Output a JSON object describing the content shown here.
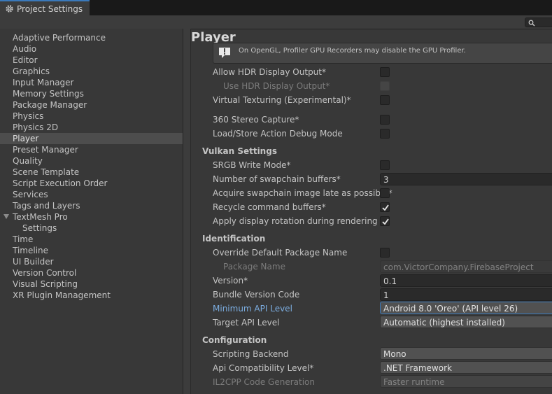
{
  "window": {
    "tab_title": "Project Settings",
    "search_placeholder": ""
  },
  "sidebar": {
    "items": [
      {
        "label": "Adaptive Performance"
      },
      {
        "label": "Audio"
      },
      {
        "label": "Editor"
      },
      {
        "label": "Graphics"
      },
      {
        "label": "Input Manager"
      },
      {
        "label": "Memory Settings"
      },
      {
        "label": "Package Manager"
      },
      {
        "label": "Physics"
      },
      {
        "label": "Physics 2D"
      },
      {
        "label": "Player",
        "selected": true
      },
      {
        "label": "Preset Manager"
      },
      {
        "label": "Quality"
      },
      {
        "label": "Scene Template"
      },
      {
        "label": "Script Execution Order"
      },
      {
        "label": "Services"
      },
      {
        "label": "Tags and Layers"
      },
      {
        "label": "TextMesh Pro",
        "expanded": true
      },
      {
        "label": "Settings",
        "child": true
      },
      {
        "label": "Time"
      },
      {
        "label": "Timeline"
      },
      {
        "label": "UI Builder"
      },
      {
        "label": "Version Control"
      },
      {
        "label": "Visual Scripting"
      },
      {
        "label": "XR Plugin Management"
      }
    ]
  },
  "main": {
    "title": "Player",
    "info_text": "On OpenGL, Profiler GPU Recorders may disable the GPU Profiler.",
    "rendering": {
      "allow_hdr_label": "Allow HDR Display Output*",
      "allow_hdr_checked": false,
      "use_hdr_label": "Use HDR Display Output*",
      "use_hdr_checked": false,
      "virtual_texturing_label": "Virtual Texturing (Experimental)*",
      "virtual_texturing_checked": false,
      "stereo_label": "360 Stereo Capture*",
      "stereo_checked": false,
      "load_store_label": "Load/Store Action Debug Mode",
      "load_store_checked": false
    },
    "vulkan": {
      "header": "Vulkan Settings",
      "srgb_label": "SRGB Write Mode*",
      "srgb_checked": false,
      "swapchain_label": "Number of swapchain buffers*",
      "swapchain_value": "3",
      "acquire_label": "Acquire swapchain image late as possible*",
      "acquire_checked": false,
      "recycle_label": "Recycle command buffers*",
      "recycle_checked": true,
      "rotation_label": "Apply display rotation during rendering",
      "rotation_checked": true
    },
    "identification": {
      "header": "Identification",
      "override_label": "Override Default Package Name",
      "override_checked": false,
      "package_label": "Package Name",
      "package_value": "com.VictorCompany.FirebaseProject",
      "version_label": "Version*",
      "version_value": "0.1",
      "bundle_label": "Bundle Version Code",
      "bundle_value": "1",
      "min_api_label": "Minimum API Level",
      "min_api_value": "Android 8.0 'Oreo' (API level 26)",
      "target_api_label": "Target API Level",
      "target_api_value": "Automatic (highest installed)"
    },
    "configuration": {
      "header": "Configuration",
      "backend_label": "Scripting Backend",
      "backend_value": "Mono",
      "api_compat_label": "Api Compatibility Level*",
      "api_compat_value": ".NET Framework",
      "il2cpp_label": "IL2CPP Code Generation",
      "il2cpp_value": "Faster runtime"
    }
  },
  "colors": {
    "accent": "#3a79bb",
    "link": "#7bacdf",
    "selection": "#4d4d4d"
  }
}
